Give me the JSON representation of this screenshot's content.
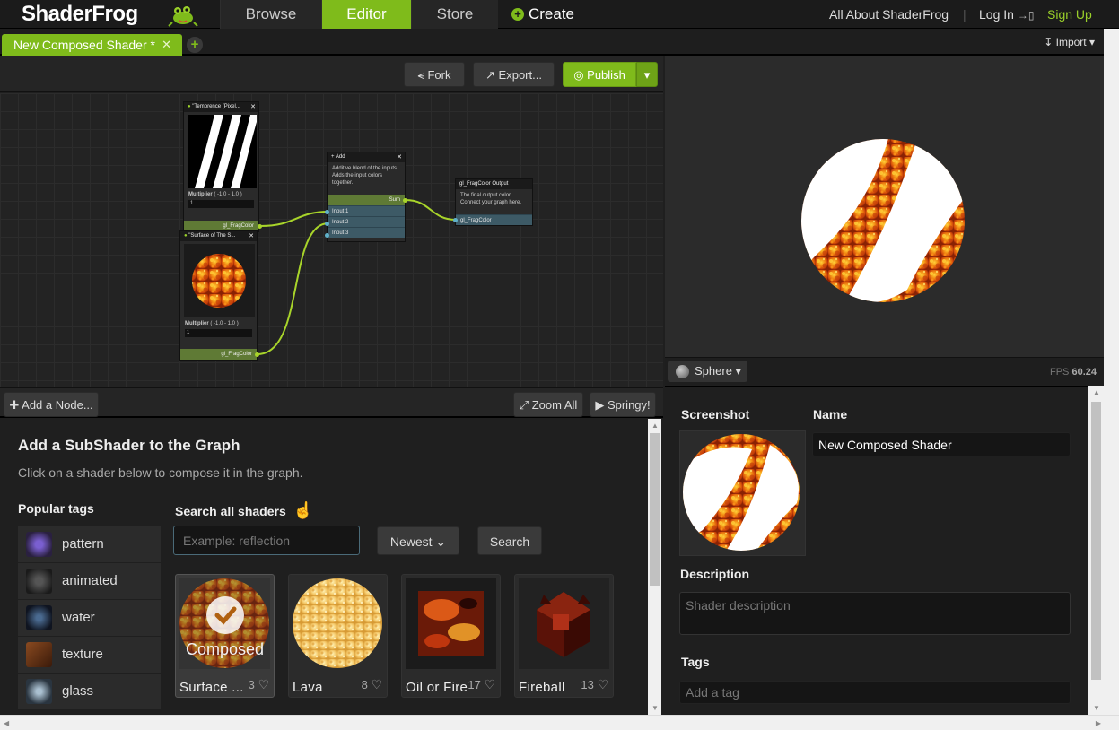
{
  "nav": {
    "logo": "ShaderFrog",
    "tabs": [
      "Browse",
      "Editor",
      "Store"
    ],
    "create": "Create",
    "about": "All About ShaderFrog",
    "separator": "|",
    "login": "Log In",
    "signup": "Sign Up"
  },
  "tabs": {
    "active_doc": "New Composed Shader *",
    "add": "+",
    "import": "Import"
  },
  "graph_toolbar": {
    "fork": "Fork",
    "export": "Export...",
    "publish": "Publish"
  },
  "graph": {
    "node_temperance": {
      "title": "\"Temprence (Pixel...",
      "multiplier_label": "Multiplier",
      "multiplier_range": "( -1.0 - 1.0 )",
      "multiplier_value": "1",
      "output": "gl_FragColor"
    },
    "node_surface": {
      "title": "\"Surface of The S...",
      "multiplier_label": "Multiplier",
      "multiplier_range": "( -1.0 - 1.0 )",
      "multiplier_value": "1",
      "output": "gl_FragColor"
    },
    "node_add": {
      "title": "Add",
      "description": "Additive blend of the inputs. Adds the input colors together.",
      "output": "Sum",
      "inputs": [
        "Input 1",
        "Input 2",
        "Input 3"
      ]
    },
    "node_output": {
      "title": "gl_FragColor Output",
      "description": "The final output color. Connect your graph here.",
      "input": "gl_FragColor"
    }
  },
  "graph_bottom": {
    "add_node": "Add a Node...",
    "zoom_all": "Zoom All",
    "springy": "Springy!"
  },
  "subshader": {
    "title": "Add a SubShader to the Graph",
    "description": "Click on a shader below to compose it in the graph.",
    "popular_tags_title": "Popular tags",
    "search_title": "Search all shaders",
    "search_placeholder": "Example: reflection",
    "sort": "Newest",
    "search_button": "Search",
    "tags": [
      {
        "label": "pattern",
        "color": "#4a3f7a"
      },
      {
        "label": "animated",
        "color": "#3a3a3a"
      },
      {
        "label": "water",
        "color": "#1c2a3c"
      },
      {
        "label": "texture",
        "color": "#6a3a1a"
      },
      {
        "label": "glass",
        "color": "#3c4a55"
      }
    ],
    "cards": [
      {
        "name": "Surface ...",
        "likes": "3",
        "overlay": "Composed",
        "selected": true
      },
      {
        "name": "Lava",
        "likes": "8",
        "selected": false
      },
      {
        "name": "Oil or Fire",
        "likes": "17",
        "selected": false
      },
      {
        "name": "Fireball",
        "likes": "13",
        "selected": false
      }
    ]
  },
  "preview": {
    "geometry": "Sphere",
    "fps_label": "FPS",
    "fps_value": "60.24"
  },
  "details": {
    "screenshot_label": "Screenshot",
    "name_label": "Name",
    "name_value": "New Composed Shader",
    "description_label": "Description",
    "description_placeholder": "Shader description",
    "tags_label": "Tags",
    "tags_placeholder": "Add a tag"
  },
  "colors": {
    "brand_green": "#7fbb1b",
    "lava_orange": "#e8701a"
  }
}
